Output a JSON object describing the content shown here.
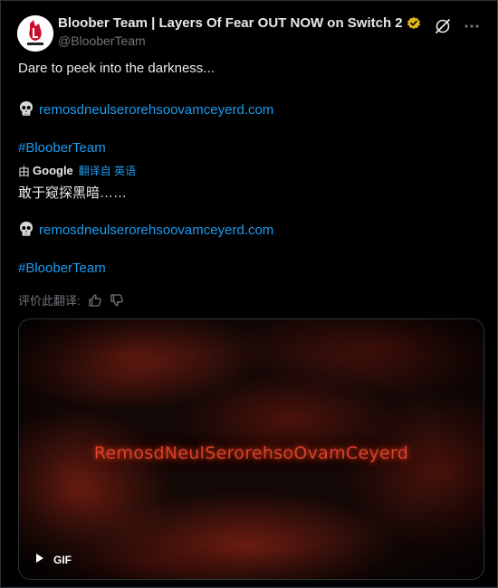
{
  "author": {
    "display_name": "Bloober Team | Layers Of Fear OUT NOW on Switch 2",
    "handle": "@BlooberTeam",
    "avatar_logo_text": "bloober"
  },
  "header_icons": [
    "grok-icon",
    "more-icon"
  ],
  "post": {
    "text_en": "Dare to peek into the darkness...",
    "link_en": "remosdneulserorehsoovamceyerd.com",
    "hashtag_en": "#BlooberTeam",
    "translated_by_prefix": "由",
    "translated_by_brand": "Google",
    "translated_from": "翻译自 英语",
    "text_zh": "敢于窥探黑暗……",
    "link_zh": "remosdneulserorehsoovamceyerd.com",
    "hashtag_zh": "#BlooberTeam",
    "rate_label": "评价此翻译:"
  },
  "media": {
    "overlay_text": "RemosdNeulSerorehsoOvamCeyerd",
    "badge_label": "GIF"
  },
  "colors": {
    "link": "#1d9bf0",
    "verified": "#e2b719",
    "glow_red": "#d9402a"
  }
}
